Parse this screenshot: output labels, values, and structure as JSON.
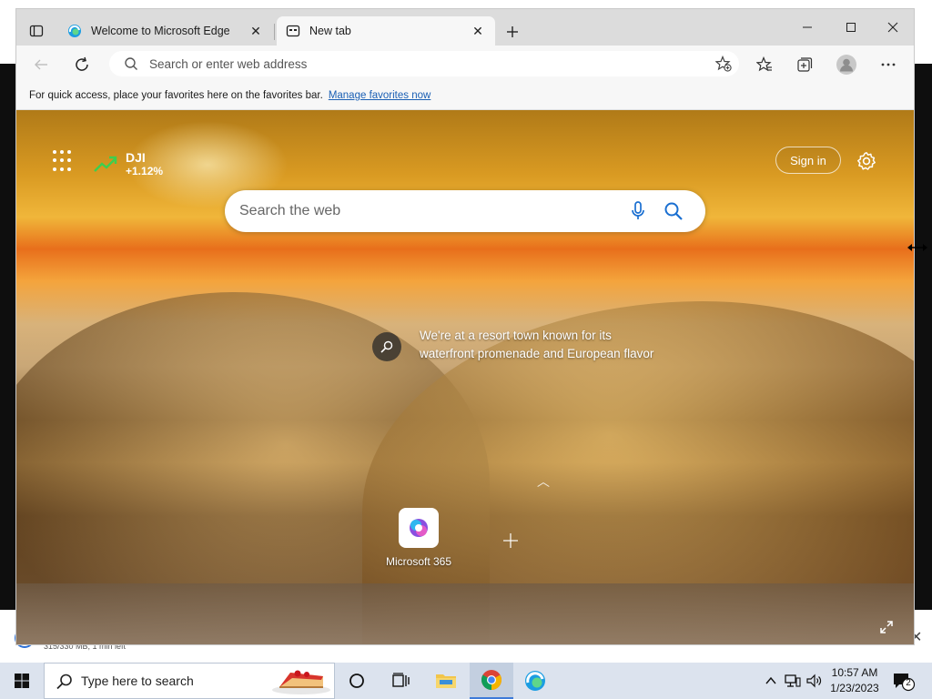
{
  "browser": {
    "tabs": [
      {
        "title": "Welcome to Microsoft Edge",
        "active": false
      },
      {
        "title": "New tab",
        "active": true
      }
    ],
    "address_placeholder": "Search or enter web address",
    "favorites_bar_text": "For quick access, place your favorites here on the favorites bar.",
    "favorites_link": "Manage favorites now"
  },
  "ntp": {
    "stock_symbol": "DJI",
    "stock_change": "+1.12%",
    "sign_in": "Sign in",
    "search_placeholder": "Search the web",
    "image_info": "We're at a resort town known for its waterfront promenade and European flavor",
    "quick_links": [
      {
        "label": "Microsoft 365"
      }
    ]
  },
  "background": {
    "download_status": "315/330 MB, 1 min left"
  },
  "taskbar": {
    "search_placeholder": "Type here to search",
    "time": "10:57 AM",
    "date": "1/23/2023",
    "notification_count": "2"
  },
  "colors": {
    "stock_up": "#3ccf4e",
    "link": "#1a5fb4",
    "accent": "#3d7bd9"
  }
}
